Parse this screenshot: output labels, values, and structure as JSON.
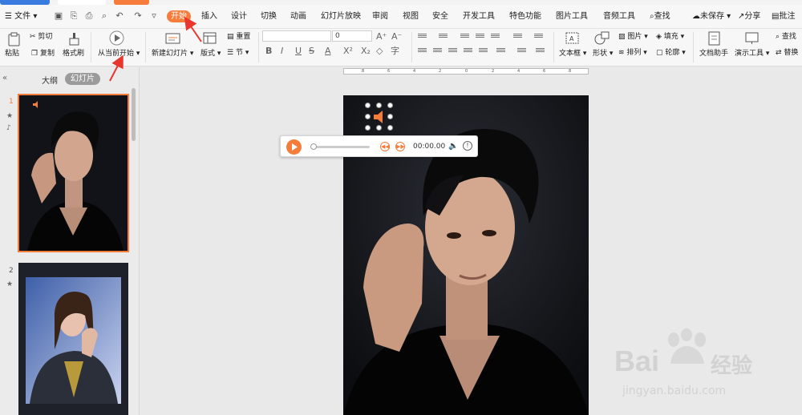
{
  "menubar": {
    "file_label": "文件",
    "tabs": [
      {
        "label": "开始",
        "active": true
      },
      {
        "label": "插入"
      },
      {
        "label": "设计"
      },
      {
        "label": "切换"
      },
      {
        "label": "动画"
      },
      {
        "label": "幻灯片放映"
      },
      {
        "label": "审阅"
      },
      {
        "label": "视图"
      },
      {
        "label": "安全"
      },
      {
        "label": "开发工具"
      },
      {
        "label": "特色功能"
      },
      {
        "label": "图片工具"
      },
      {
        "label": "音频工具"
      }
    ],
    "search_label": "查找",
    "unsaved_label": "未保存",
    "share_label": "分享",
    "comment_label": "批注"
  },
  "ribbon": {
    "paste": "粘贴",
    "cut": "剪切",
    "copy": "复制",
    "format_painter": "格式刷",
    "play_from_current": "从当前开始",
    "new_slide": "新建幻灯片",
    "layout": "版式",
    "reset": "重置",
    "section": "节",
    "font_size": "0",
    "textbox": "文本框",
    "shape": "形状",
    "picture": "图片",
    "arrange": "排列",
    "fill": "填充",
    "outline": "轮廓",
    "doc_assistant": "文档助手",
    "present_tools": "演示工具",
    "find": "查找",
    "replace": "替换"
  },
  "ruler": {
    "ticks": [
      "8",
      "6",
      "4",
      "2",
      "0",
      "2",
      "4",
      "6",
      "8"
    ]
  },
  "panel": {
    "tab_outline": "大纲",
    "tab_slides": "幻灯片",
    "slide_numbers": [
      "1",
      "2"
    ]
  },
  "audio_player": {
    "time": "00:00.00"
  },
  "watermark": {
    "brand": "Bai",
    "brand2": "经验",
    "url": "jingyan.baidu.com"
  },
  "colors": {
    "accent": "#f57c3a",
    "annotation_arrow": "#e8352e"
  }
}
